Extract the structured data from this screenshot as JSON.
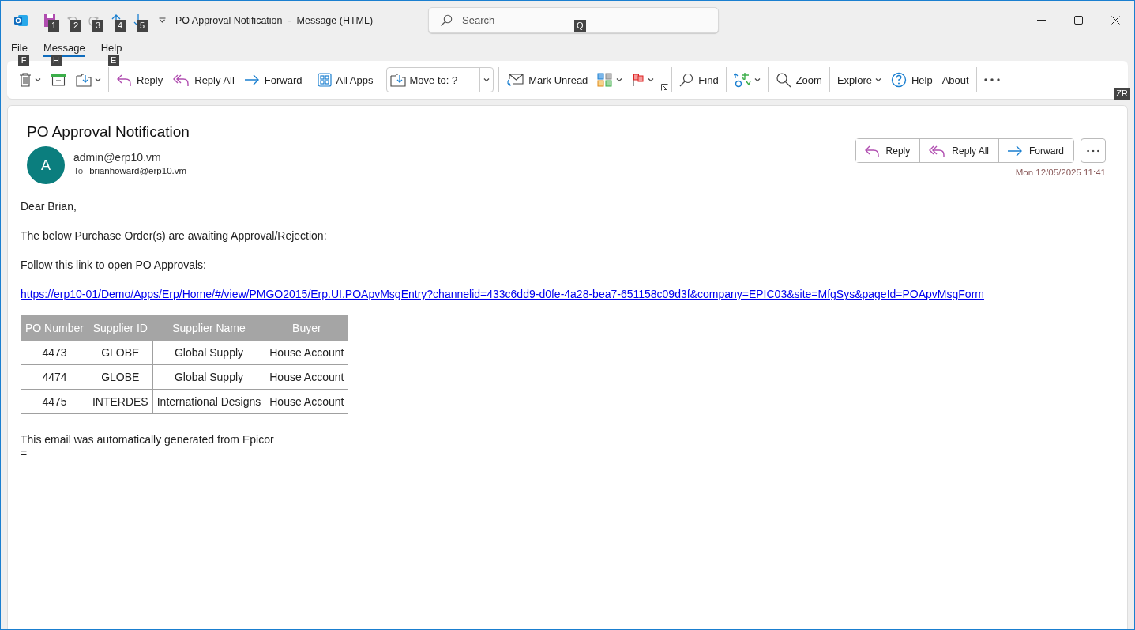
{
  "window": {
    "title": "PO Approval Notification  -  Message (HTML)",
    "quick_access": [
      {
        "kind": "save",
        "keytip": "1",
        "disabled": false
      },
      {
        "kind": "undo",
        "keytip": "2",
        "disabled": true
      },
      {
        "kind": "redo",
        "keytip": "3",
        "disabled": true
      },
      {
        "kind": "up",
        "keytip": "4",
        "disabled": false
      },
      {
        "kind": "down",
        "keytip": "5",
        "disabled": false
      }
    ],
    "search": {
      "placeholder": "Search",
      "keytip": "Q"
    }
  },
  "menu_tabs": [
    {
      "label": "File",
      "keytip": "F",
      "selected": false
    },
    {
      "label": "Message",
      "keytip": "H",
      "selected": true
    },
    {
      "label": "Help",
      "keytip": "E",
      "selected": false
    }
  ],
  "ribbon": {
    "groups": [
      [
        {
          "kind": "delete",
          "dropdown": true
        },
        {
          "kind": "archive",
          "dropdown": false
        },
        {
          "kind": "move",
          "dropdown": true
        }
      ],
      [
        {
          "kind": "reply",
          "label": "Reply",
          "dropdown": false
        },
        {
          "kind": "replyall",
          "label": "Reply All",
          "dropdown": false
        },
        {
          "kind": "forward",
          "label": "Forward",
          "dropdown": false
        }
      ],
      [
        {
          "kind": "apps",
          "label": "All Apps",
          "dropdown": false
        }
      ],
      [
        {
          "kind": "moveto",
          "label": "Move to: ?",
          "dropdown": true
        }
      ],
      [
        {
          "kind": "unread",
          "label": "Mark Unread",
          "dropdown": false
        },
        {
          "kind": "categorize",
          "dropdown": true
        },
        {
          "kind": "flag",
          "dropdown": true
        },
        {
          "kind": "launcher"
        }
      ],
      [
        {
          "kind": "find",
          "label": "Find",
          "dropdown": false
        }
      ],
      [
        {
          "kind": "translate",
          "dropdown": true
        }
      ],
      [
        {
          "kind": "zoom",
          "label": "Zoom",
          "dropdown": false
        }
      ],
      [
        {
          "kind": "text",
          "label": "Explore",
          "dropdown": true
        },
        {
          "kind": "help",
          "label": "Help",
          "dropdown": false
        },
        {
          "kind": "text",
          "label": "About",
          "dropdown": false
        }
      ],
      [
        {
          "kind": "more",
          "dropdown": false
        }
      ]
    ],
    "collapse_keytip": "ZR"
  },
  "message": {
    "subject": "PO Approval Notification",
    "avatar": "A",
    "from": "admin@erp10.vm",
    "to_label": "To",
    "to": "brianhoward@erp10.vm",
    "actions": [
      {
        "kind": "reply",
        "label": "Reply"
      },
      {
        "kind": "replyall",
        "label": "Reply All"
      },
      {
        "kind": "forward",
        "label": "Forward"
      }
    ],
    "date": "Mon 12/05/2025 11:41",
    "body": [
      {
        "kind": "text",
        "text": "Dear Brian,"
      },
      {
        "kind": "text",
        "text": "The below Purchase Order(s) are awaiting Approval/Rejection:"
      },
      {
        "kind": "text",
        "text": "Follow this link to open PO Approvals:"
      },
      {
        "kind": "link",
        "text": "https://erp10-01/Demo/Apps/Erp/Home/#/view/PMGO2015/Erp.UI.POApvMsgEntry?channelid=433c6dd9-d0fe-4a28-bea7-651158c09d3f&company=EPIC03&site=MfgSys&pageId=POApvMsgForm"
      }
    ],
    "table": {
      "columns": [
        "PO Number",
        "Supplier ID",
        "Supplier Name",
        "Buyer"
      ],
      "rows": [
        [
          "4473",
          "GLOBE",
          "Global Supply",
          "House Account"
        ],
        [
          "4474",
          "GLOBE",
          "Global Supply",
          "House Account"
        ],
        [
          "4475",
          "INTERDES",
          "International Designs",
          "House Account"
        ]
      ]
    },
    "footer": [
      "This email was automatically generated from Epicor",
      "="
    ]
  }
}
